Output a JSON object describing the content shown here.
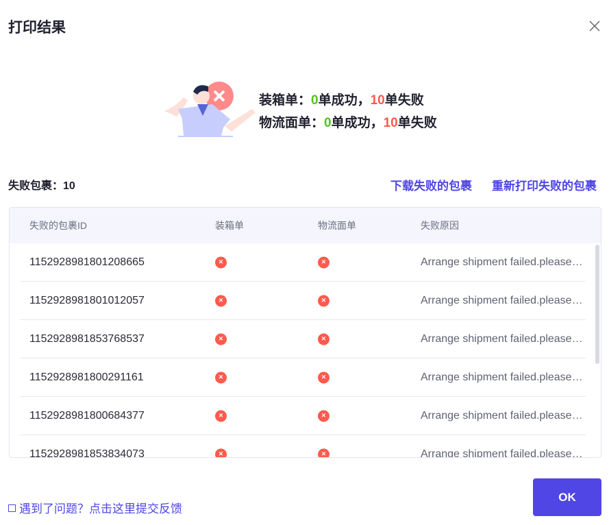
{
  "dialog": {
    "title": "打印结果"
  },
  "summary": {
    "packing": {
      "label": "装箱单：",
      "success": "0",
      "success_text": "单成功，",
      "fail": "10",
      "fail_text": "单失败"
    },
    "logistics": {
      "label": "物流面单：",
      "success": "0",
      "success_text": "单成功，",
      "fail": "10",
      "fail_text": "单失败"
    }
  },
  "failed": {
    "label": "失败包裹：",
    "count": "10"
  },
  "actions": {
    "download": "下载失败的包裹",
    "reprint": "重新打印失败的包裹"
  },
  "table": {
    "headers": [
      "失败的包裹ID",
      "装箱单",
      "物流面单",
      "失败原因"
    ],
    "rows": [
      {
        "id": "1152928981801208665",
        "packing": "×",
        "logistics": "×",
        "reason": "Arrange shipment failed.please try again"
      },
      {
        "id": "1152928981801012057",
        "packing": "×",
        "logistics": "×",
        "reason": "Arrange shipment failed.please try again"
      },
      {
        "id": "1152928981853768537",
        "packing": "×",
        "logistics": "×",
        "reason": "Arrange shipment failed.please try again"
      },
      {
        "id": "1152928981800291161",
        "packing": "×",
        "logistics": "×",
        "reason": "Arrange shipment failed.please try again"
      },
      {
        "id": "1152928981800684377",
        "packing": "×",
        "logistics": "×",
        "reason": "Arrange shipment failed.please try again"
      },
      {
        "id": "1152928981853834073",
        "packing": "×",
        "logistics": "×",
        "reason": "Arrange shipment failed.please try again"
      }
    ]
  },
  "footer": {
    "feedback": "遇到了问题？点击这里提交反馈",
    "ok": "OK"
  }
}
